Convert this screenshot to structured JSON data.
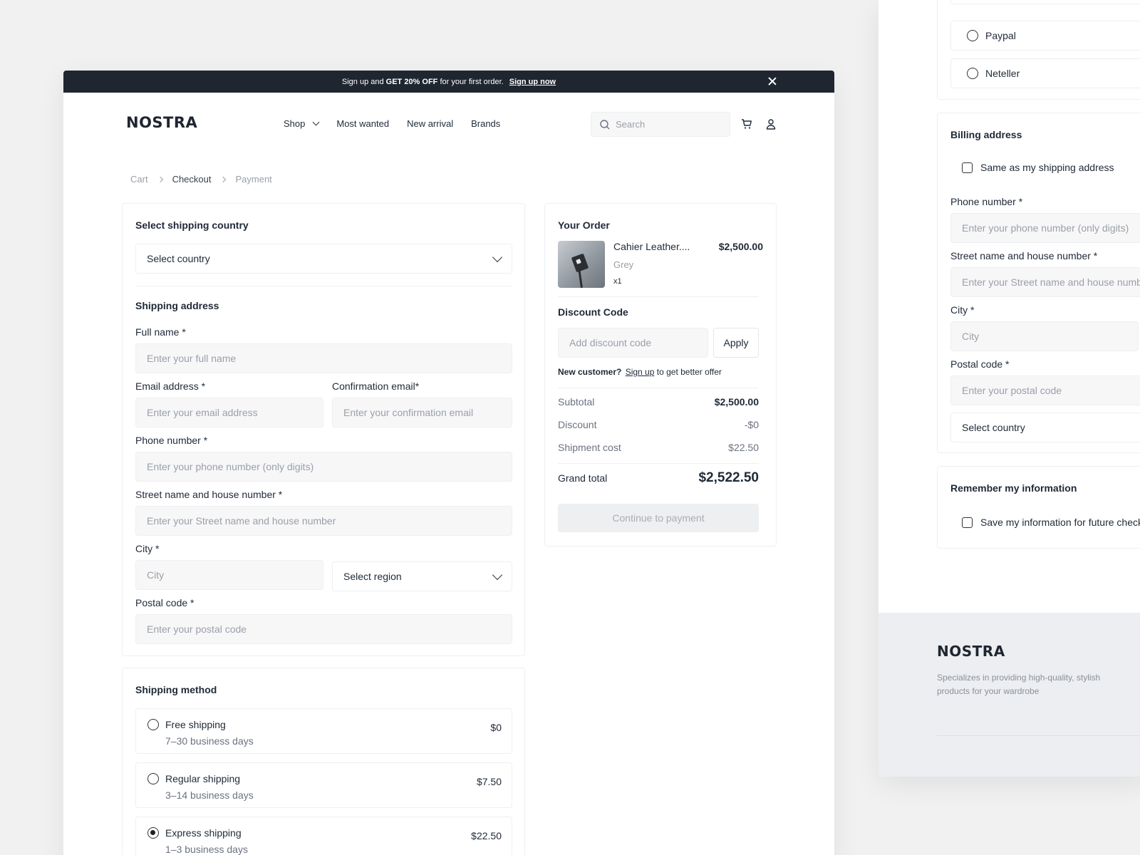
{
  "promo": {
    "prefix": "Sign up and",
    "bold": "GET 20% OFF",
    "suffix": "for your first order.",
    "link": "Sign up now"
  },
  "brand": {
    "logo": "NOSTRA"
  },
  "nav": {
    "shop": "Shop",
    "most_wanted": "Most wanted",
    "new_arrival": "New arrival",
    "brands": "Brands"
  },
  "search": {
    "placeholder": "Search"
  },
  "breadcrumb": {
    "cart": "Cart",
    "checkout": "Checkout",
    "payment": "Payment"
  },
  "shipping_country": {
    "title": "Select shipping country",
    "select": "Select country"
  },
  "shipping_address": {
    "title": "Shipping address",
    "full_name_label": "Full name *",
    "full_name_ph": "Enter your full name",
    "email_label": "Email address *",
    "email_ph": "Enter your email address",
    "confirm_label": "Confirmation email*",
    "confirm_ph": "Enter your confirmation email",
    "phone_label": "Phone number *",
    "phone_ph": "Enter your phone number (only digits)",
    "street_label": "Street name and house number *",
    "street_ph": "Enter your Street name and house number",
    "city_label": "City *",
    "city_ph": "City",
    "region_select": "Select region",
    "postal_label": "Postal code *",
    "postal_ph": "Enter your postal code"
  },
  "shipping_method": {
    "title": "Shipping method",
    "options": [
      {
        "name": "Free shipping",
        "days": "7–30 business days",
        "price": "$0",
        "selected": false
      },
      {
        "name": "Regular shipping",
        "days": "3–14 business days",
        "price": "$7.50",
        "selected": false
      },
      {
        "name": "Express shipping",
        "days": "1–3 business days",
        "price": "$22.50",
        "selected": true
      }
    ]
  },
  "order": {
    "title": "Your Order",
    "item": {
      "name": "Cahier Leather....",
      "variant": "Grey",
      "qty": "x1",
      "price": "$2,500.00"
    },
    "discount_title": "Discount Code",
    "discount_ph": "Add discount code",
    "apply": "Apply",
    "new_customer": "New customer?",
    "sign_up": "Sign up",
    "offer_text": "to get better offer",
    "subtotal_label": "Subtotal",
    "subtotal": "$2,500.00",
    "discount_label": "Discount",
    "discount": "-$0",
    "shipment_label": "Shipment cost",
    "shipment": "$22.50",
    "grand_label": "Grand total",
    "grand": "$2,522.50",
    "continue": "Continue to payment"
  },
  "side": {
    "paypal": "Paypal",
    "neteller": "Neteller",
    "billing_title": "Billing address",
    "same_as_shipping": "Same as my shipping address",
    "phone_label": "Phone number *",
    "phone_ph": "Enter your phone number (only digits)",
    "street_label": "Street name and house number *",
    "street_ph": "Enter your Street name and house number",
    "city_label": "City *",
    "city_ph": "City",
    "postal_label": "Postal code *",
    "postal_ph": "Enter your postal code",
    "country_select": "Select country",
    "remember_title": "Remember my information",
    "save_info": "Save my information for future checkout",
    "footer_logo": "NOSTRA",
    "footer_text": "Specializes in providing high-quality, stylish products for your wardrobe"
  }
}
